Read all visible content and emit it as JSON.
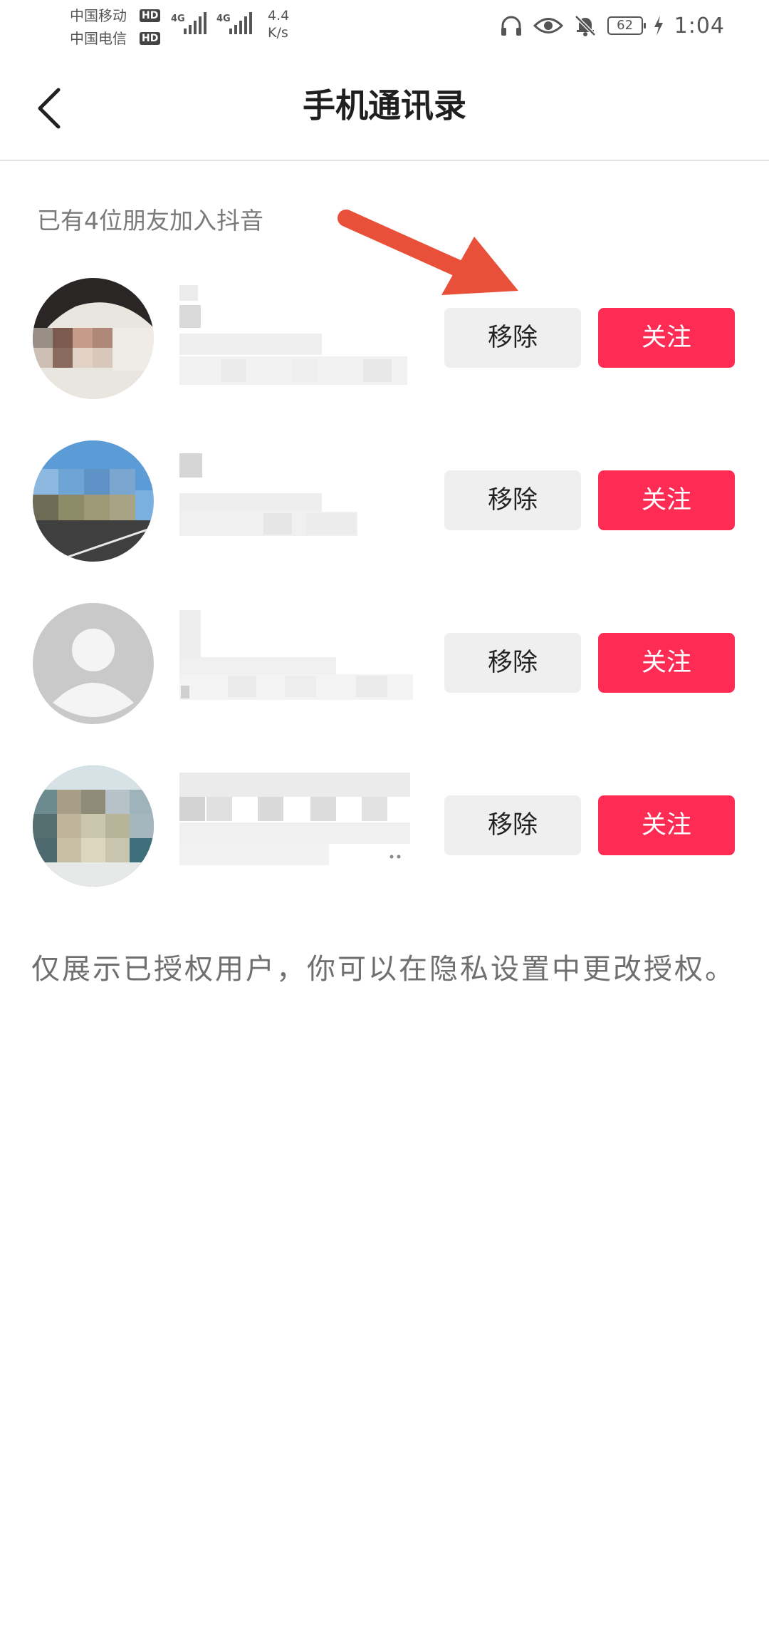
{
  "status_bar": {
    "carrier_1": "中国移动",
    "carrier_2": "中国电信",
    "hd_badge": "HD",
    "network_1": "4G",
    "network_2": "4G",
    "speed_value": "4.4",
    "speed_unit": "K/s",
    "icons": [
      "headphones-icon",
      "eye-icon",
      "bell-muted-icon",
      "battery-icon",
      "charging-icon"
    ],
    "battery_level": "62",
    "time": "1:04"
  },
  "nav": {
    "back_icon": "chevron-left-icon",
    "title": "手机通讯录"
  },
  "content": {
    "friends_count_label": "已有4位朋友加入抖音",
    "friends": [
      {
        "remove_label": "移除",
        "follow_label": "关注"
      },
      {
        "remove_label": "移除",
        "follow_label": "关注"
      },
      {
        "remove_label": "移除",
        "follow_label": "关注"
      },
      {
        "remove_label": "移除",
        "follow_label": "关注"
      }
    ],
    "footnote": "仅展示已授权用户，你可以在隐私设置中更改授权。"
  },
  "colors": {
    "follow_button": "#fe2c55",
    "remove_button": "#efefef",
    "annotation_arrow": "#e8503a",
    "title_text": "#1f1f1f",
    "secondary_text": "#7a7a7a"
  }
}
